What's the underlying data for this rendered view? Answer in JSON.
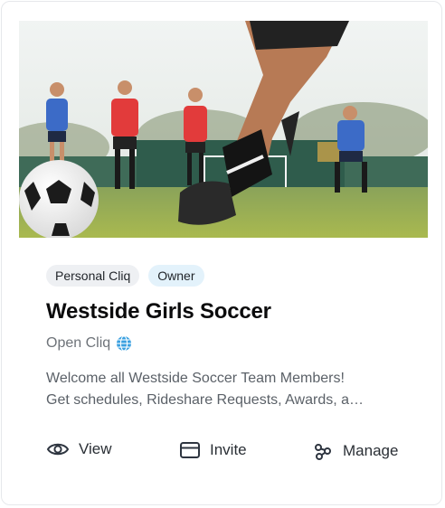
{
  "card": {
    "image": {
      "alt": "Youth soccer players on a field, foreground player kicking a ball"
    },
    "chips": [
      {
        "label": "Personal Cliq"
      },
      {
        "label": "Owner"
      }
    ],
    "title": "Westside Girls Soccer",
    "cliq_type": "Open Cliq",
    "description_lines": [
      "Welcome all Westside Soccer Team Members!",
      "Get schedules, Rideshare Requests, Awards, a…"
    ],
    "actions": {
      "view": "View",
      "invite": "Invite",
      "manage": "Manage"
    },
    "colors": {
      "owner_chip_bg": "#e3f2fb",
      "personal_chip_bg": "#eef0f3",
      "globe_icon": "#3aa0e0"
    }
  }
}
